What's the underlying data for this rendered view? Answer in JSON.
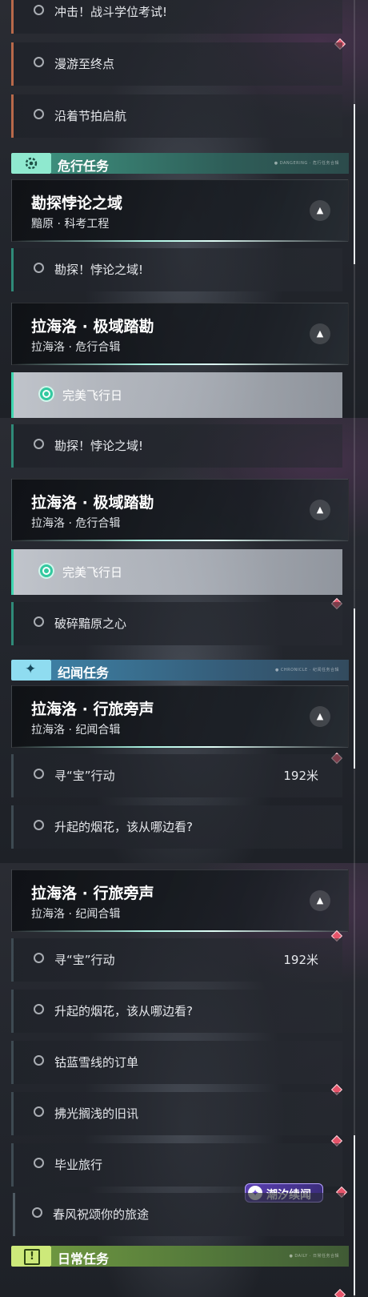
{
  "panel1": {
    "items_top": [
      {
        "label": "冲击！战斗学位考试!"
      },
      {
        "label": "漫游至终点"
      },
      {
        "label": "沿着节拍启航"
      }
    ],
    "danger_header": {
      "title": "危行任务",
      "fine": "● DANGERING · 危行任务合辑"
    },
    "quest1": {
      "title": "勘探悖论之域",
      "subtitle": "黯原 · 科考工程",
      "sub": "勘探！悖论之域!"
    },
    "quest2": {
      "title": "拉海洛 · 极域踏勘",
      "subtitle": "拉海洛 · 危行合辑",
      "active_sub": "完美飞行日"
    }
  },
  "panel2": {
    "sub_top": "勘探！悖论之域!",
    "quest": {
      "title": "拉海洛 · 极域踏勘",
      "subtitle": "拉海洛 · 危行合辑"
    },
    "active_sub": "完美飞行日",
    "sub_break": "破碎黯原之心",
    "story_header": {
      "title": "纪闻任务",
      "fine": "● CHRONICLE · 纪闻任务合辑"
    },
    "story_quest": {
      "title": "拉海洛 · 行旅旁声",
      "subtitle": "拉海洛 · 纪闻合辑"
    },
    "treasure": {
      "label": "寻“宝”行动",
      "distance": "192米"
    },
    "fireworks": "升起的烟花，该从哪边看?"
  },
  "panel3": {
    "quest": {
      "title": "拉海洛 · 行旅旁声",
      "subtitle": "拉海洛 · 纪闻合辑"
    },
    "treasure": {
      "label": "寻“宝”行动",
      "distance": "192米"
    },
    "items": [
      {
        "label": "升起的烟花，该从哪边看?"
      },
      {
        "label": "钴蓝雪线的订单"
      },
      {
        "label": "拂光搁浅的旧讯"
      },
      {
        "label": "毕业旅行"
      },
      {
        "label": "春风祝颂你的旅途"
      }
    ],
    "daily_header": {
      "title": "日常任务",
      "fine": "● DAILY · 日常任务合辑"
    },
    "badge": {
      "text": "潮汐续闻",
      "logo": "✦"
    }
  },
  "icons": {
    "collapse": "▲",
    "sparkle": "✦",
    "alert": "!"
  },
  "colors": {
    "accent_teal": "#3fd6b0",
    "marker_red": "#e6546a",
    "story_blue": "#8fdcf0",
    "daily_lime": "#cde97a"
  }
}
